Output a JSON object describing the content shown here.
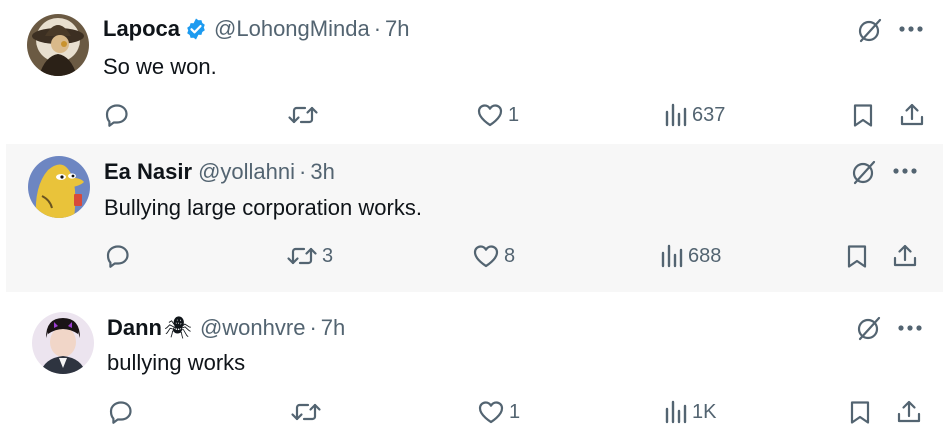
{
  "tweets": [
    {
      "name": "Lapoca",
      "verified": true,
      "handle": "@LohongMinda",
      "separator": "·",
      "time": "7h",
      "text": "So we won.",
      "replies": "",
      "retweets": "",
      "likes": "1",
      "views": "637",
      "avatar": "hat-figure-avatar"
    },
    {
      "name": "Ea Nasir",
      "verified": false,
      "handle": "@yollahni",
      "separator": "·",
      "time": "3h",
      "text": "Bullying large corporation works.",
      "replies": "",
      "retweets": "3",
      "likes": "8",
      "views": "688",
      "avatar": "yellow-fish-avatar"
    },
    {
      "name": "Dann",
      "name_emoji": "🕷",
      "verified": false,
      "handle": "@wonhvre",
      "separator": "·",
      "time": "7h",
      "text": "bullying works",
      "replies": "",
      "retweets": "",
      "likes": "1",
      "views": "1K",
      "avatar": "person-avatar"
    }
  ],
  "colors": {
    "verified": "#1d9bf0",
    "muted": "#536471",
    "text": "#0f1419",
    "highlight_bg": "#f7f7f7"
  }
}
